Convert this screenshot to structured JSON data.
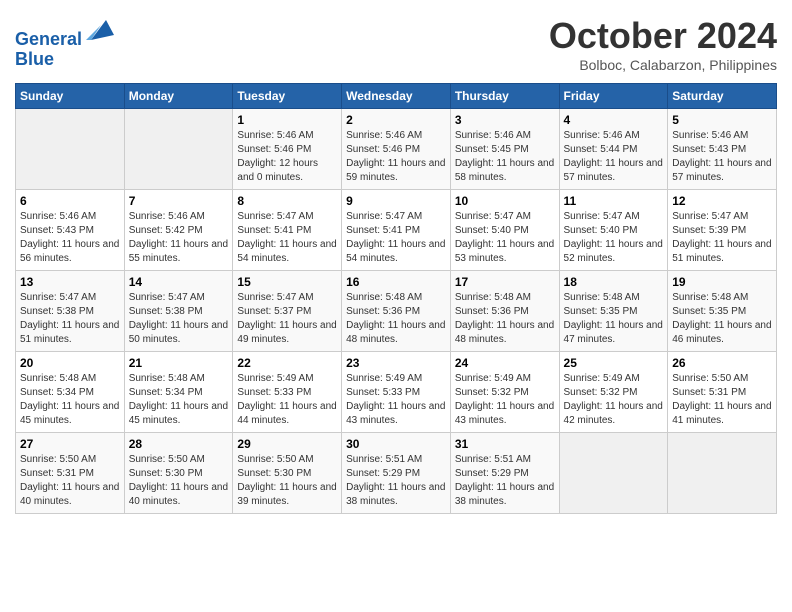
{
  "header": {
    "logo_line1": "General",
    "logo_line2": "Blue",
    "month": "October 2024",
    "location": "Bolboc, Calabarzon, Philippines"
  },
  "weekdays": [
    "Sunday",
    "Monday",
    "Tuesday",
    "Wednesday",
    "Thursday",
    "Friday",
    "Saturday"
  ],
  "weeks": [
    [
      {
        "day": "",
        "sunrise": "",
        "sunset": "",
        "daylight": ""
      },
      {
        "day": "",
        "sunrise": "",
        "sunset": "",
        "daylight": ""
      },
      {
        "day": "1",
        "sunrise": "Sunrise: 5:46 AM",
        "sunset": "Sunset: 5:46 PM",
        "daylight": "Daylight: 12 hours and 0 minutes."
      },
      {
        "day": "2",
        "sunrise": "Sunrise: 5:46 AM",
        "sunset": "Sunset: 5:46 PM",
        "daylight": "Daylight: 11 hours and 59 minutes."
      },
      {
        "day": "3",
        "sunrise": "Sunrise: 5:46 AM",
        "sunset": "Sunset: 5:45 PM",
        "daylight": "Daylight: 11 hours and 58 minutes."
      },
      {
        "day": "4",
        "sunrise": "Sunrise: 5:46 AM",
        "sunset": "Sunset: 5:44 PM",
        "daylight": "Daylight: 11 hours and 57 minutes."
      },
      {
        "day": "5",
        "sunrise": "Sunrise: 5:46 AM",
        "sunset": "Sunset: 5:43 PM",
        "daylight": "Daylight: 11 hours and 57 minutes."
      }
    ],
    [
      {
        "day": "6",
        "sunrise": "Sunrise: 5:46 AM",
        "sunset": "Sunset: 5:43 PM",
        "daylight": "Daylight: 11 hours and 56 minutes."
      },
      {
        "day": "7",
        "sunrise": "Sunrise: 5:46 AM",
        "sunset": "Sunset: 5:42 PM",
        "daylight": "Daylight: 11 hours and 55 minutes."
      },
      {
        "day": "8",
        "sunrise": "Sunrise: 5:47 AM",
        "sunset": "Sunset: 5:41 PM",
        "daylight": "Daylight: 11 hours and 54 minutes."
      },
      {
        "day": "9",
        "sunrise": "Sunrise: 5:47 AM",
        "sunset": "Sunset: 5:41 PM",
        "daylight": "Daylight: 11 hours and 54 minutes."
      },
      {
        "day": "10",
        "sunrise": "Sunrise: 5:47 AM",
        "sunset": "Sunset: 5:40 PM",
        "daylight": "Daylight: 11 hours and 53 minutes."
      },
      {
        "day": "11",
        "sunrise": "Sunrise: 5:47 AM",
        "sunset": "Sunset: 5:40 PM",
        "daylight": "Daylight: 11 hours and 52 minutes."
      },
      {
        "day": "12",
        "sunrise": "Sunrise: 5:47 AM",
        "sunset": "Sunset: 5:39 PM",
        "daylight": "Daylight: 11 hours and 51 minutes."
      }
    ],
    [
      {
        "day": "13",
        "sunrise": "Sunrise: 5:47 AM",
        "sunset": "Sunset: 5:38 PM",
        "daylight": "Daylight: 11 hours and 51 minutes."
      },
      {
        "day": "14",
        "sunrise": "Sunrise: 5:47 AM",
        "sunset": "Sunset: 5:38 PM",
        "daylight": "Daylight: 11 hours and 50 minutes."
      },
      {
        "day": "15",
        "sunrise": "Sunrise: 5:47 AM",
        "sunset": "Sunset: 5:37 PM",
        "daylight": "Daylight: 11 hours and 49 minutes."
      },
      {
        "day": "16",
        "sunrise": "Sunrise: 5:48 AM",
        "sunset": "Sunset: 5:36 PM",
        "daylight": "Daylight: 11 hours and 48 minutes."
      },
      {
        "day": "17",
        "sunrise": "Sunrise: 5:48 AM",
        "sunset": "Sunset: 5:36 PM",
        "daylight": "Daylight: 11 hours and 48 minutes."
      },
      {
        "day": "18",
        "sunrise": "Sunrise: 5:48 AM",
        "sunset": "Sunset: 5:35 PM",
        "daylight": "Daylight: 11 hours and 47 minutes."
      },
      {
        "day": "19",
        "sunrise": "Sunrise: 5:48 AM",
        "sunset": "Sunset: 5:35 PM",
        "daylight": "Daylight: 11 hours and 46 minutes."
      }
    ],
    [
      {
        "day": "20",
        "sunrise": "Sunrise: 5:48 AM",
        "sunset": "Sunset: 5:34 PM",
        "daylight": "Daylight: 11 hours and 45 minutes."
      },
      {
        "day": "21",
        "sunrise": "Sunrise: 5:48 AM",
        "sunset": "Sunset: 5:34 PM",
        "daylight": "Daylight: 11 hours and 45 minutes."
      },
      {
        "day": "22",
        "sunrise": "Sunrise: 5:49 AM",
        "sunset": "Sunset: 5:33 PM",
        "daylight": "Daylight: 11 hours and 44 minutes."
      },
      {
        "day": "23",
        "sunrise": "Sunrise: 5:49 AM",
        "sunset": "Sunset: 5:33 PM",
        "daylight": "Daylight: 11 hours and 43 minutes."
      },
      {
        "day": "24",
        "sunrise": "Sunrise: 5:49 AM",
        "sunset": "Sunset: 5:32 PM",
        "daylight": "Daylight: 11 hours and 43 minutes."
      },
      {
        "day": "25",
        "sunrise": "Sunrise: 5:49 AM",
        "sunset": "Sunset: 5:32 PM",
        "daylight": "Daylight: 11 hours and 42 minutes."
      },
      {
        "day": "26",
        "sunrise": "Sunrise: 5:50 AM",
        "sunset": "Sunset: 5:31 PM",
        "daylight": "Daylight: 11 hours and 41 minutes."
      }
    ],
    [
      {
        "day": "27",
        "sunrise": "Sunrise: 5:50 AM",
        "sunset": "Sunset: 5:31 PM",
        "daylight": "Daylight: 11 hours and 40 minutes."
      },
      {
        "day": "28",
        "sunrise": "Sunrise: 5:50 AM",
        "sunset": "Sunset: 5:30 PM",
        "daylight": "Daylight: 11 hours and 40 minutes."
      },
      {
        "day": "29",
        "sunrise": "Sunrise: 5:50 AM",
        "sunset": "Sunset: 5:30 PM",
        "daylight": "Daylight: 11 hours and 39 minutes."
      },
      {
        "day": "30",
        "sunrise": "Sunrise: 5:51 AM",
        "sunset": "Sunset: 5:29 PM",
        "daylight": "Daylight: 11 hours and 38 minutes."
      },
      {
        "day": "31",
        "sunrise": "Sunrise: 5:51 AM",
        "sunset": "Sunset: 5:29 PM",
        "daylight": "Daylight: 11 hours and 38 minutes."
      },
      {
        "day": "",
        "sunrise": "",
        "sunset": "",
        "daylight": ""
      },
      {
        "day": "",
        "sunrise": "",
        "sunset": "",
        "daylight": ""
      }
    ]
  ]
}
